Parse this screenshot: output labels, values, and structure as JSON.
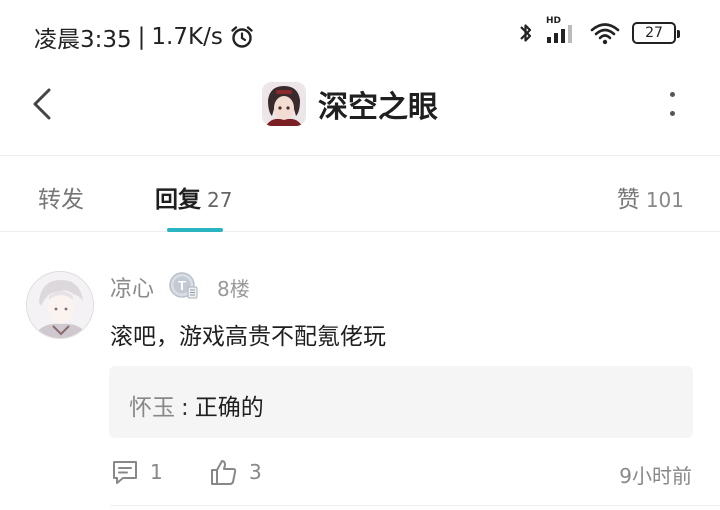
{
  "status_bar": {
    "time": "凌晨3:35",
    "separator": "|",
    "speed": "1.7K/s",
    "battery": "27",
    "network_label": "HD",
    "icons": [
      "alarm-icon",
      "bluetooth-icon",
      "signal-icon",
      "wifi-icon",
      "battery-icon"
    ]
  },
  "header": {
    "title": "深空之眼",
    "icons": [
      "back-arrow-icon",
      "game-icon",
      "more-icon"
    ]
  },
  "tabs": [
    {
      "label": "转发",
      "count": ""
    },
    {
      "label": "回复",
      "count": "27"
    },
    {
      "label": "赞",
      "count": "101"
    }
  ],
  "active_tab": "回复",
  "accent_color": "#2ab3c0",
  "comment": {
    "username": "凉心",
    "floor": "8楼",
    "text": "滚吧，游戏高贵不配氪佬玩",
    "reply": {
      "user": "怀玉",
      "separator": ":",
      "text": "正确的"
    },
    "comment_count": "1",
    "like_count": "3",
    "time": "9小时前",
    "icons": [
      "avatar",
      "level-badge-icon",
      "comment-icon",
      "like-icon"
    ]
  }
}
